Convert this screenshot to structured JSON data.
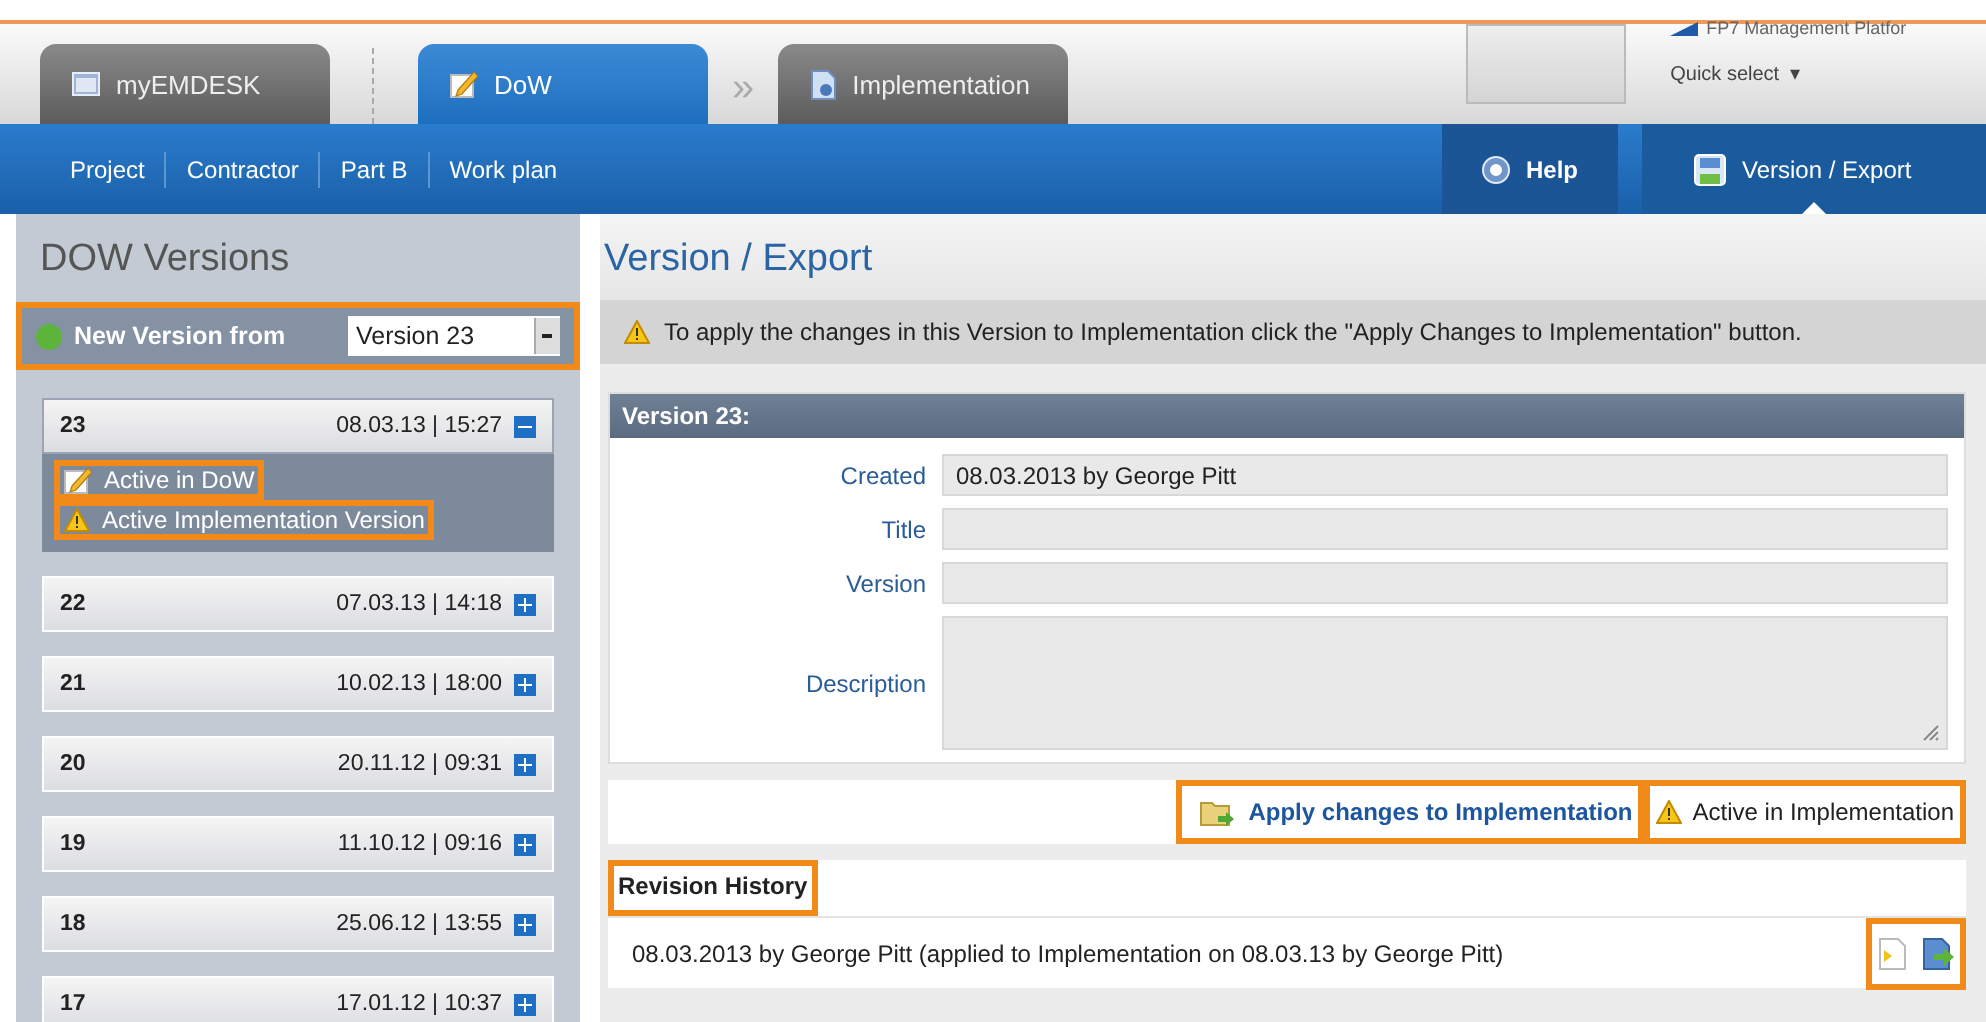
{
  "top_tabs": [
    {
      "label": "myEMDESK",
      "kind": "desk",
      "selected": false
    },
    {
      "label": "DoW",
      "kind": "pencil",
      "selected": true
    },
    {
      "label": "Implementation",
      "kind": "document",
      "selected": false
    }
  ],
  "tab_separator": "»",
  "platform": {
    "name": "FP7 Management Platfor",
    "quick_select": "Quick select",
    "quick_select_caret": "▾"
  },
  "nav": {
    "items": [
      "Project",
      "Contractor",
      "Part B",
      "Work plan"
    ],
    "actions": [
      {
        "label": "Help",
        "kind": "help",
        "selected": false
      },
      {
        "label": "Version / Export",
        "kind": "export",
        "selected": true
      }
    ]
  },
  "sidebar": {
    "title": "DOW Versions",
    "new_version": {
      "label": "New Version from",
      "value": "Version 23",
      "highlighted": true
    },
    "versions": [
      {
        "number": "23",
        "date": "08.03.13 | 15:27",
        "expanded": true,
        "statuses": [
          {
            "label": "Active in DoW",
            "kind": "pencil",
            "highlighted": true
          },
          {
            "label": "Active Implementation Version",
            "kind": "warning",
            "highlighted": true
          }
        ]
      },
      {
        "number": "22",
        "date": "07.03.13 | 14:18",
        "expanded": false
      },
      {
        "number": "21",
        "date": "10.02.13 | 18:00",
        "expanded": false
      },
      {
        "number": "20",
        "date": "20.11.12 | 09:31",
        "expanded": false
      },
      {
        "number": "19",
        "date": "11.10.12 | 09:16",
        "expanded": false
      },
      {
        "number": "18",
        "date": "25.06.12 | 13:55",
        "expanded": false
      },
      {
        "number": "17",
        "date": "17.01.12 | 10:37",
        "expanded": false
      }
    ]
  },
  "content": {
    "title": "Version / Export",
    "notice": "To apply the changes in this Version to Implementation click the \"Apply Changes to Implementation\" button.",
    "panel_title": "Version 23:",
    "fields": [
      {
        "label": "Created",
        "value": "08.03.2013 by George Pitt",
        "kind": "text"
      },
      {
        "label": "Title",
        "kind": "text"
      },
      {
        "label": "Version",
        "kind": "text"
      },
      {
        "label": "Description",
        "kind": "textarea"
      }
    ],
    "apply_button": {
      "label": "Apply changes to Implementation",
      "highlighted": true
    },
    "active_label": {
      "label": "Active in Implementation",
      "highlighted": true
    },
    "revision_history": {
      "title": "Revision History",
      "highlighted": true,
      "entries": [
        {
          "text": "08.03.2013 by George Pitt (applied to Implementation on 08.03.13 by George Pitt)",
          "actions_highlighted": true
        }
      ]
    }
  }
}
